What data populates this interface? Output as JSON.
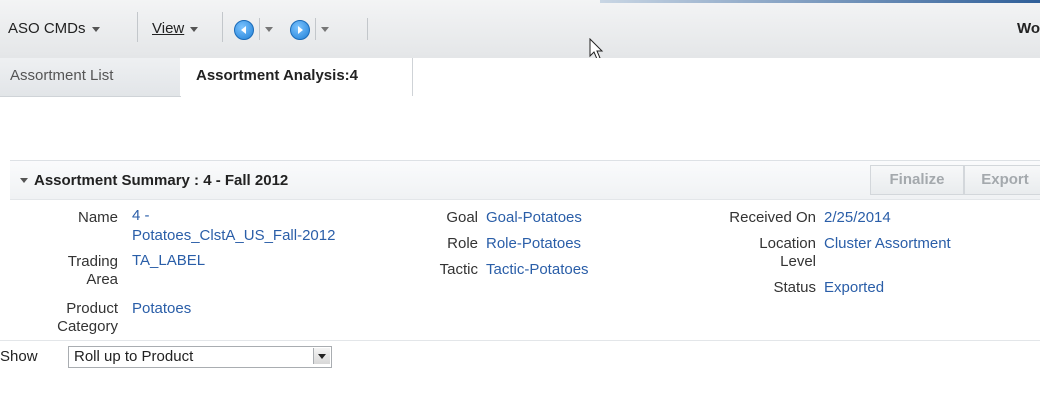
{
  "toolbar": {
    "aso_cmds": "ASO CMDs",
    "view": "View",
    "right_text": "Wo"
  },
  "tabs": [
    {
      "label": "Assortment List",
      "active": false
    },
    {
      "label": "Assortment Analysis:4",
      "active": true
    }
  ],
  "summary": {
    "title": "Assortment Summary : 4 - Fall 2012",
    "buttons": {
      "finalize": "Finalize",
      "export": "Export"
    },
    "fields": {
      "name": {
        "label": "Name",
        "value_line1": "4 -",
        "value_line2": "Potatoes_ClstA_US_Fall-2012"
      },
      "trading_area": {
        "label_line1": "Trading",
        "label_line2": "Area",
        "value": "TA_LABEL"
      },
      "product_category": {
        "label_line1": "Product",
        "label_line2": "Category",
        "value": "Potatoes"
      },
      "goal": {
        "label": "Goal",
        "value": "Goal-Potatoes"
      },
      "role": {
        "label": "Role",
        "value": "Role-Potatoes"
      },
      "tactic": {
        "label": "Tactic",
        "value": "Tactic-Potatoes"
      },
      "received_on": {
        "label": "Received On",
        "value": "2/25/2014"
      },
      "location_level": {
        "label_line1": "Location",
        "label_line2": "Level",
        "value": "Cluster Assortment"
      },
      "status": {
        "label": "Status",
        "value": "Exported"
      }
    }
  },
  "show": {
    "label": "Show",
    "selected": "Roll up to Product"
  },
  "colors": {
    "link": "#2a5ea8",
    "accent": "#1f7fd6"
  },
  "icons": [
    "dropdown-caret-icon",
    "back-nav-icon",
    "forward-nav-icon",
    "mouse-cursor-icon",
    "collapse-chevron-icon"
  ]
}
